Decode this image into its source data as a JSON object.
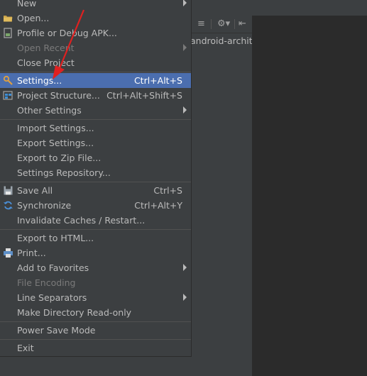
{
  "toolbar": {
    "icons": [
      "collapse-icon",
      "gear-icon",
      "pin-icon"
    ]
  },
  "editor_tab": {
    "path_text": "android-archite"
  },
  "menu": {
    "new": "New",
    "open": "Open...",
    "profile": "Profile or Debug APK...",
    "open_recent": "Open Recent",
    "close_project": "Close Project",
    "settings": "Settings...",
    "settings_shortcut": "Ctrl+Alt+S",
    "project_structure": "Project Structure...",
    "project_structure_shortcut": "Ctrl+Alt+Shift+S",
    "other_settings": "Other Settings",
    "import_settings": "Import Settings...",
    "export_settings": "Export Settings...",
    "export_zip": "Export to Zip File...",
    "settings_repo": "Settings Repository...",
    "save_all": "Save All",
    "save_all_shortcut": "Ctrl+S",
    "synchronize": "Synchronize",
    "synchronize_shortcut": "Ctrl+Alt+Y",
    "invalidate": "Invalidate Caches / Restart...",
    "export_html": "Export to HTML...",
    "print": "Print...",
    "add_favorites": "Add to Favorites",
    "file_encoding": "File Encoding",
    "line_separators": "Line Separators",
    "make_readonly": "Make Directory Read-only",
    "power_save": "Power Save Mode",
    "exit": "Exit"
  },
  "colors": {
    "menu_bg": "#3c3f41",
    "selection": "#4b6eaf",
    "editor_bg": "#2b2b2b",
    "annotation_arrow": "#e02020"
  }
}
